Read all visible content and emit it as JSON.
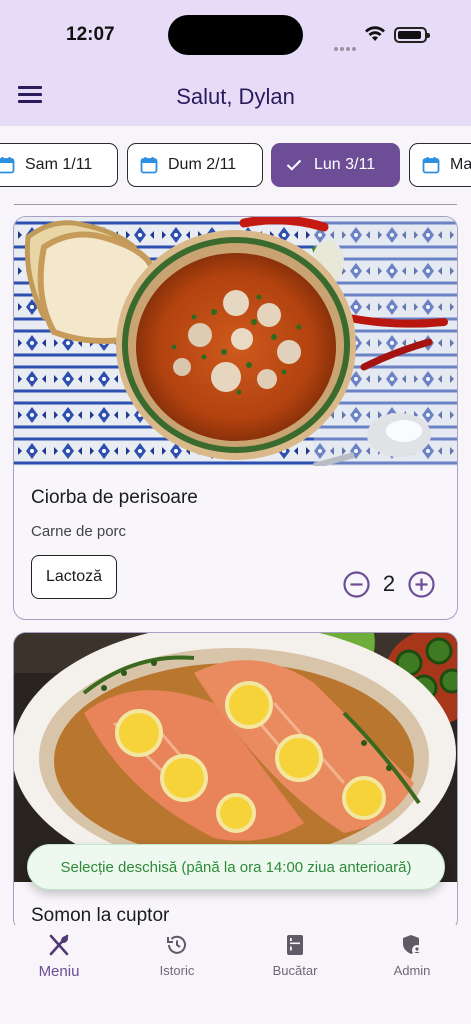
{
  "status_bar": {
    "time": "12:07"
  },
  "header": {
    "title": "Salut, Dylan",
    "menu_icon": "menu-icon"
  },
  "dates": [
    {
      "label": "Sam 1/11",
      "selected": false
    },
    {
      "label": "Dum 2/11",
      "selected": false
    },
    {
      "label": "Lun 3/11",
      "selected": true
    },
    {
      "label": "Ma",
      "selected": false
    }
  ],
  "meals": [
    {
      "title": "Ciorba de perisoare",
      "subtitle": "Carne de porc",
      "allergen": "Lactoză",
      "quantity": "2"
    },
    {
      "title": "Somon la cuptor"
    }
  ],
  "toast": {
    "text": "Selecție deschisă (până la ora 14:00 ziua anterioară)"
  },
  "nav": {
    "items": [
      {
        "label": "Meniu",
        "icon": "utensils-icon",
        "active": true
      },
      {
        "label": "Istoric",
        "icon": "history-icon",
        "active": false
      },
      {
        "label": "Bucătar",
        "icon": "kitchen-icon",
        "active": false
      },
      {
        "label": "Admin",
        "icon": "admin-shield-icon",
        "active": false
      }
    ]
  },
  "colors": {
    "accent": "#6d4e96",
    "topbar": "#e6dcf8",
    "toast_text": "#2f8a3a"
  }
}
